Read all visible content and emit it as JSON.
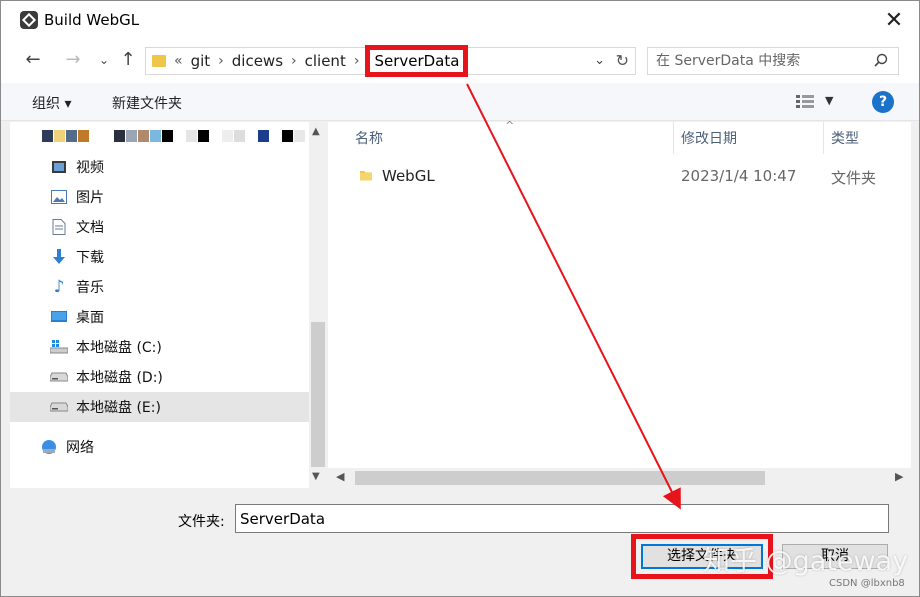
{
  "window": {
    "title": "Build WebGL"
  },
  "address": {
    "crumbs": [
      "git",
      "dicews",
      "client"
    ],
    "current": "ServerData",
    "overflow": "«"
  },
  "search": {
    "placeholder": "在 ServerData 中搜索"
  },
  "toolbar": {
    "organize": "组织 ▾",
    "new_folder": "新建文件夹",
    "help": "?"
  },
  "nav": {
    "items": [
      {
        "label": "视频",
        "icon": "video-icon"
      },
      {
        "label": "图片",
        "icon": "picture-icon"
      },
      {
        "label": "文档",
        "icon": "document-icon"
      },
      {
        "label": "下载",
        "icon": "download-icon"
      },
      {
        "label": "音乐",
        "icon": "music-icon"
      },
      {
        "label": "桌面",
        "icon": "desktop-icon"
      },
      {
        "label": "本地磁盘 (C:)",
        "icon": "drive-c-icon"
      },
      {
        "label": "本地磁盘 (D:)",
        "icon": "drive-icon"
      },
      {
        "label": "本地磁盘 (E:)",
        "icon": "drive-icon",
        "selected": true
      },
      {
        "label": "网络",
        "icon": "network-icon"
      }
    ]
  },
  "columns": {
    "name": "名称",
    "date": "修改日期",
    "type": "类型"
  },
  "files": [
    {
      "name": "WebGL",
      "date": "2023/1/4 10:47",
      "type": "文件夹"
    }
  ],
  "footer": {
    "folder_label": "文件夹:",
    "folder_value": "ServerData",
    "select_button": "选择文件夹",
    "cancel_button": "取消"
  },
  "watermark": {
    "main": "知乎 @gateway",
    "sub": "CSDN @lbxnb8"
  },
  "colors": {
    "highlight": "#e8141b",
    "accent": "#0078d7"
  }
}
